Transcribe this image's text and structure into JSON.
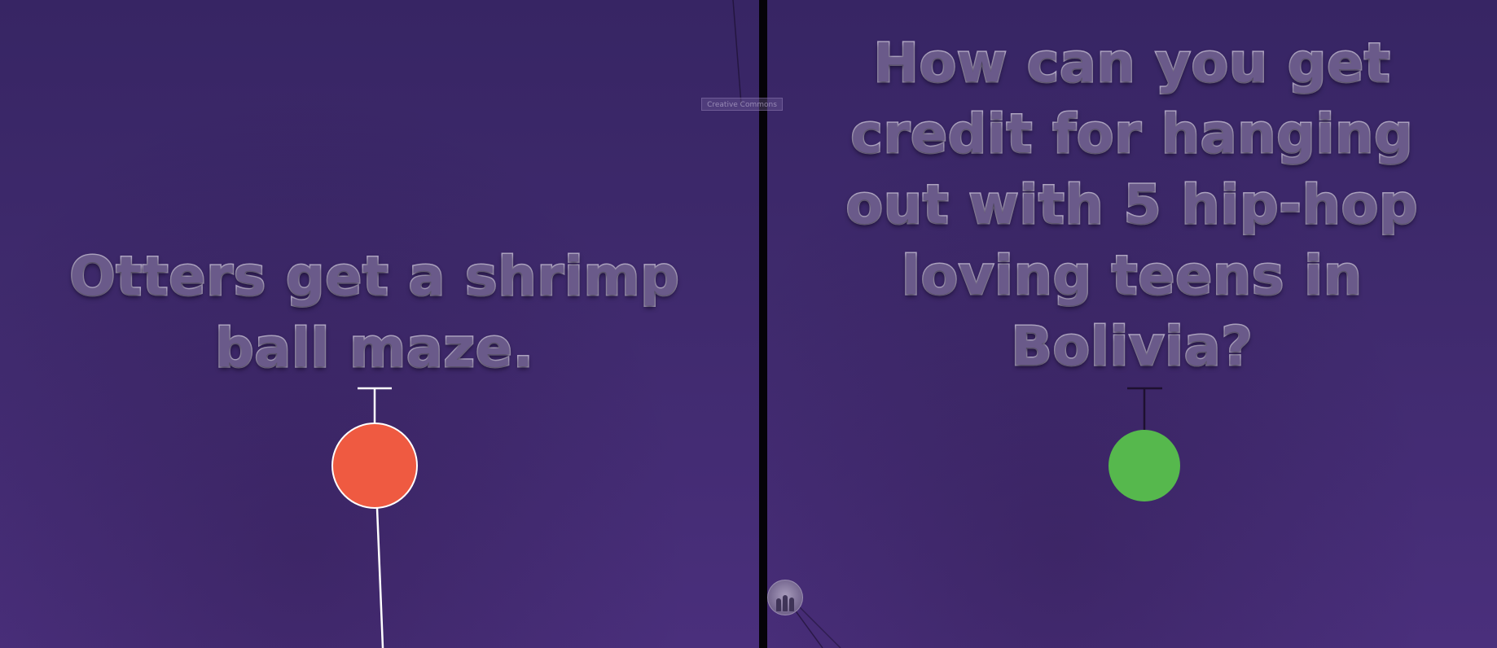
{
  "left_panel": {
    "caption_lines": [
      "Otters get a shrimp",
      "ball maze."
    ],
    "credit_tag": "Creative Commons",
    "marker_color": "#ef5a41",
    "marker_border": "#ffffff",
    "stem_color": "#ffffff"
  },
  "right_panel": {
    "caption_lines": [
      "How can you get",
      "credit for hanging",
      "out with 5 hip-hop",
      "loving teens in",
      "Bolivia?"
    ],
    "marker_color": "#56b84d",
    "stem_color": "#1e1030"
  },
  "icons": {
    "left_marker": "red-circle-marker-icon",
    "right_marker": "green-circle-marker-icon",
    "avatar": "group-avatar-icon"
  }
}
